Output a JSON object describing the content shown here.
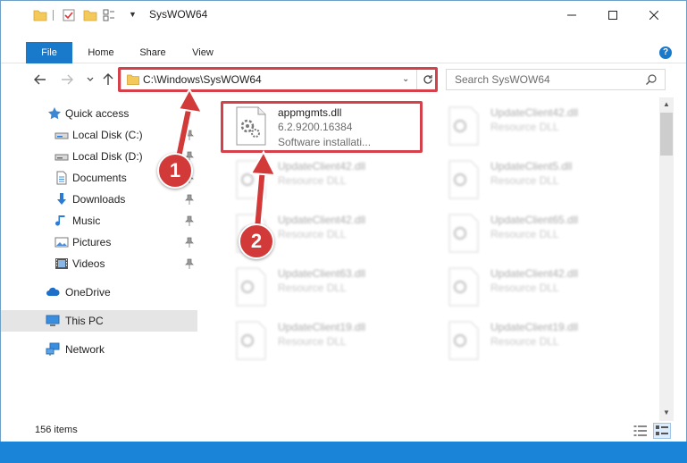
{
  "window": {
    "title": "SysWOW64"
  },
  "ribbon": {
    "tabs": [
      "File",
      "Home",
      "Share",
      "View"
    ],
    "expand_glyph": "?"
  },
  "nav": {
    "address": "C:\\Windows\\SysWOW64",
    "search_placeholder": "Search SysWOW64"
  },
  "sidebar": {
    "items": [
      {
        "label": "Quick access",
        "icon": "star-icon"
      },
      {
        "label": "Local Disk (C:)",
        "icon": "drive-icon",
        "pinned": true
      },
      {
        "label": "Local Disk (D:)",
        "icon": "drive-icon",
        "pinned": true
      },
      {
        "label": "Documents",
        "icon": "documents-icon",
        "pinned": true
      },
      {
        "label": "Downloads",
        "icon": "download-icon",
        "pinned": true
      },
      {
        "label": "Music",
        "icon": "music-icon",
        "pinned": true
      },
      {
        "label": "Pictures",
        "icon": "pictures-icon",
        "pinned": true
      },
      {
        "label": "Videos",
        "icon": "videos-icon",
        "pinned": true
      },
      {
        "label": "OneDrive",
        "icon": "cloud-icon"
      },
      {
        "label": "This PC",
        "icon": "pc-icon",
        "selected": true
      },
      {
        "label": "Network",
        "icon": "network-icon"
      }
    ]
  },
  "files": [
    {
      "name": "appmgmts.dll",
      "line1": "6.2.9200.16384",
      "line2": "Software installati...",
      "highlighted": true
    },
    {
      "name": "UpdateClient42.dll",
      "line1": "Resource DLL",
      "line2": ""
    },
    {
      "name": "UpdateClient42.dll",
      "line1": "Resource DLL",
      "line2": ""
    },
    {
      "name": "UpdateClient5.dll",
      "line1": "Resource DLL",
      "line2": ""
    },
    {
      "name": "UpdateClient42.dll",
      "line1": "Resource DLL",
      "line2": ""
    },
    {
      "name": "UpdateClient65.dll",
      "line1": "Resource DLL",
      "line2": ""
    },
    {
      "name": "UpdateClient63.dll",
      "line1": "Resource DLL",
      "line2": ""
    },
    {
      "name": "UpdateClient42.dll",
      "line1": "Resource DLL",
      "line2": ""
    },
    {
      "name": "UpdateClient19.dll",
      "line1": "Resource DLL",
      "line2": ""
    },
    {
      "name": "UpdateClient19.dll",
      "line1": "Resource DLL",
      "line2": ""
    }
  ],
  "status": {
    "item_count": "156 items"
  },
  "callouts": {
    "one": "1",
    "two": "2"
  },
  "colors": {
    "accent": "#1979ca",
    "highlight": "#d5414a",
    "callout": "#d23a3a",
    "selected": "#e5e5e5"
  }
}
